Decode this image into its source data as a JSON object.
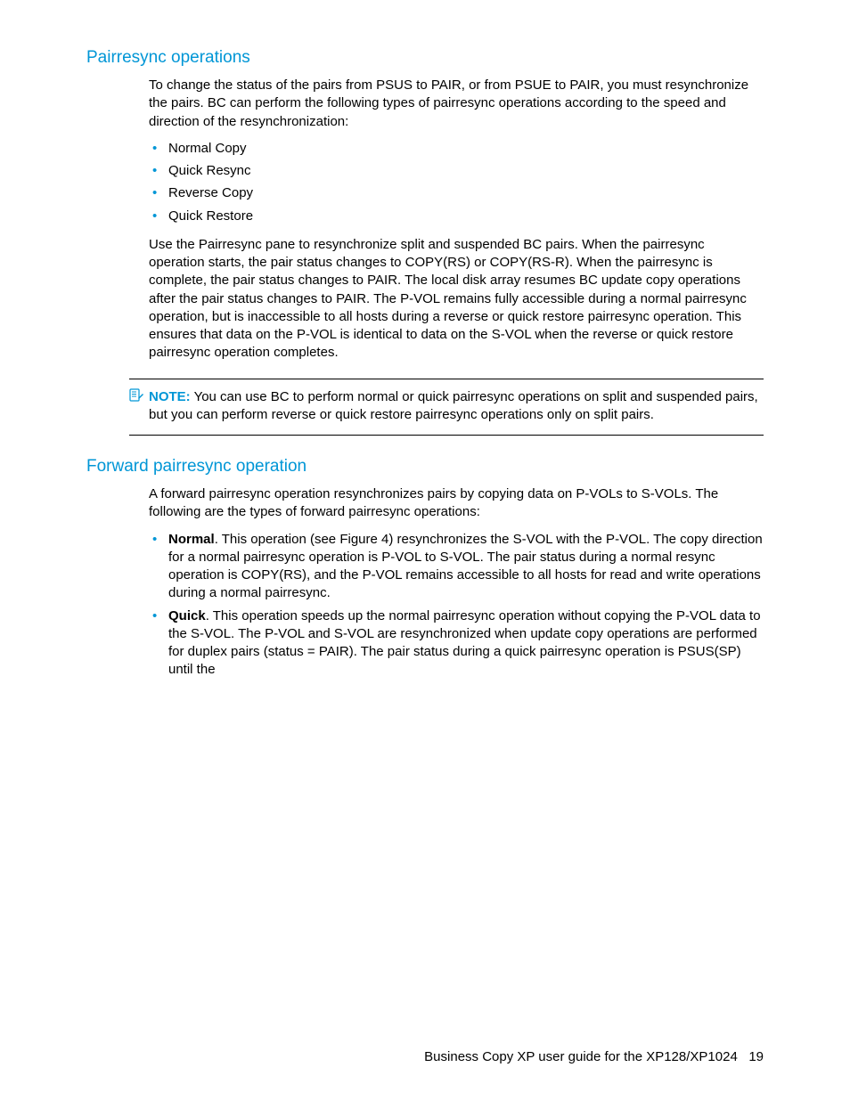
{
  "section1": {
    "heading": "Pairresync operations",
    "intro": "To change the status of the pairs from PSUS to PAIR, or from PSUE to PAIR, you must resynchronize the pairs. BC can perform the following types of pairresync operations according to the speed and direction of the resynchronization:",
    "items": [
      "Normal Copy",
      "Quick Resync",
      "Reverse Copy",
      "Quick Restore"
    ],
    "para2": "Use the Pairresync pane to resynchronize split and suspended BC pairs. When the pairresync operation starts, the pair status changes to COPY(RS) or COPY(RS-R). When the pairresync is complete, the pair status changes to PAIR. The local disk array resumes BC update copy operations after the pair status changes to PAIR. The P-VOL remains fully accessible during a normal pairresync operation, but is inaccessible to all hosts during a reverse or quick restore pairresync operation. This ensures that data on the P-VOL is identical to data on the S-VOL when the reverse or quick restore pairresync operation completes.",
    "note_label": "NOTE:",
    "note_text": "You can use BC to perform normal or quick pairresync operations on split and suspended pairs, but you can perform reverse or quick restore pairresync operations only on split pairs."
  },
  "section2": {
    "heading": "Forward pairresync operation",
    "intro": "A forward pairresync operation resynchronizes pairs by copying data on P-VOLs to S-VOLs. The following are the types of forward pairresync operations:",
    "items": [
      {
        "label": "Normal",
        "text": ". This operation (see Figure 4) resynchronizes the S-VOL with the P-VOL. The copy direction for a normal pairresync operation is P-VOL to S-VOL. The pair status during a normal resync operation is COPY(RS), and the P-VOL remains accessible to all hosts for read and write operations during a normal pairresync."
      },
      {
        "label": "Quick",
        "text": ". This operation speeds up the normal pairresync operation without copying the P-VOL data to the S-VOL. The P-VOL and S-VOL are resynchronized when update copy operations are performed for duplex pairs (status = PAIR). The pair status during a quick pairresync operation is PSUS(SP) until the"
      }
    ]
  },
  "footer": {
    "title": "Business Copy XP user guide for the XP128/XP1024",
    "page": "19"
  }
}
